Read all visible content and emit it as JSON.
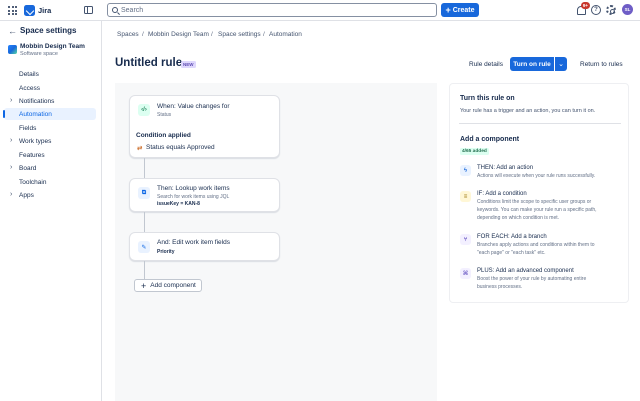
{
  "topbar": {
    "brand": "Jira",
    "search_placeholder": "Search",
    "create_label": "Create",
    "notifications_badge": "9+",
    "help_glyph": "?",
    "avatar_initials": "SL",
    "icons": [
      "app-grid-icon",
      "jira-logo",
      "sidebar-toggle-icon",
      "search-icon",
      "plus-icon",
      "bell-icon",
      "help-icon",
      "gear-icon"
    ],
    "accent": "#1868db"
  },
  "sidebar": {
    "back_glyph": "←",
    "title": "Space settings",
    "space_name": "Mobbin Design Team",
    "space_type": "Software space",
    "items": [
      {
        "label": "Details",
        "chevron": ""
      },
      {
        "label": "Access",
        "chevron": ""
      },
      {
        "label": "Notifications",
        "chevron": "›"
      },
      {
        "label": "Automation",
        "chevron": "",
        "active": true
      },
      {
        "label": "Fields",
        "chevron": ""
      },
      {
        "label": "Work types",
        "chevron": "›"
      },
      {
        "label": "Features",
        "chevron": ""
      },
      {
        "label": "Board",
        "chevron": "›"
      },
      {
        "label": "Toolchain",
        "chevron": ""
      },
      {
        "label": "Apps",
        "chevron": "›"
      }
    ]
  },
  "breadcrumb": {
    "items": [
      "Spaces",
      "Mobbin Design Team",
      "Space settings",
      "Automation"
    ],
    "separator": "/"
  },
  "header": {
    "title": "Untitled rule",
    "lozenge": "NEW",
    "rule_details": "Rule details",
    "turn_on": "Turn on rule",
    "turn_on_chevron": "⌄",
    "return": "Return to rules"
  },
  "canvas": {
    "trigger": {
      "title": "When: Value changes for",
      "subtitle": "Status",
      "icon_glyph": "‹/›",
      "condition_heading": "Condition applied",
      "condition_glyph": "⇄",
      "condition_text": "Status equals Approved"
    },
    "action_1": {
      "title": "Then: Lookup work items",
      "subtitle": "Search for work items using JQL",
      "detail": "issueKey = KAN-8",
      "icon_glyph": "⧉"
    },
    "action_2": {
      "title": "And: Edit work item fields",
      "detail": "Priority",
      "icon_glyph": "✎"
    },
    "add_component": "Add component",
    "add_glyph": "+"
  },
  "right_panel": {
    "turn_on_heading": "Turn this rule on",
    "turn_on_text": "Your rule has a trigger and an action, you can turn it on.",
    "add_heading": "Add a component",
    "added_count": "4/65 added",
    "components": [
      {
        "title": "THEN: Add an action",
        "desc_lines": [
          "Actions will execute when your rule runs successfully."
        ],
        "glyph": "ϟ",
        "icon": "lightning-icon",
        "color": "#1868db"
      },
      {
        "title": "IF: Add a condition",
        "desc_lines": [
          "Conditions limit the scope to specific user groups or",
          "keywords. You can make your rule run a specific path,",
          "depending on which condition is met."
        ],
        "glyph": "≡",
        "icon": "filter-icon",
        "color": "#946f00"
      },
      {
        "title": "FOR EACH: Add a branch",
        "desc_lines": [
          "Branches apply actions and conditions within them to",
          "\"each page\" or \"each task\" etc."
        ],
        "glyph": "⑂",
        "icon": "branch-icon",
        "color": "#6e5dc6"
      },
      {
        "title": "PLUS: Add an advanced component",
        "desc_lines": [
          "Boost the power of your rule by automating entire",
          "business processes."
        ],
        "glyph": "⌘",
        "icon": "advanced-component-icon",
        "color": "#6e5dc6"
      }
    ]
  }
}
